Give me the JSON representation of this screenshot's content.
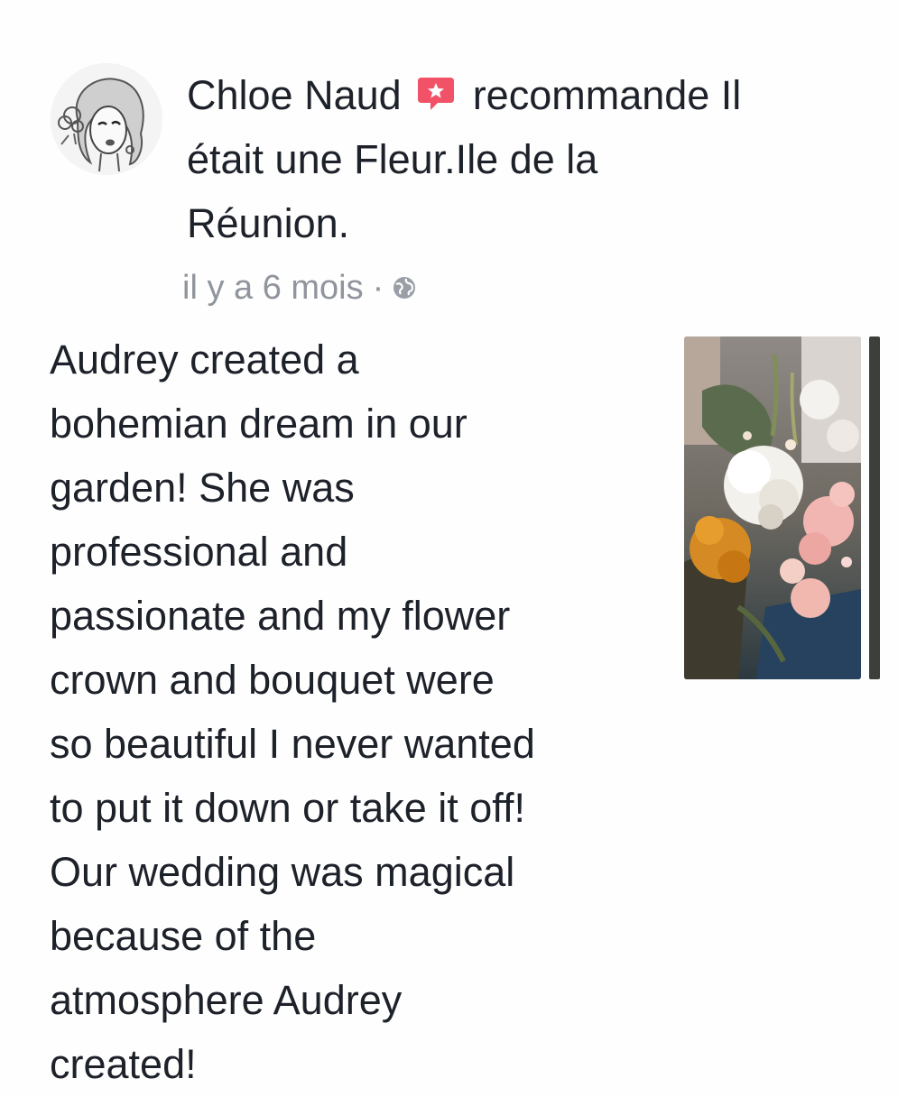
{
  "post": {
    "author": "Chloe Naud",
    "action_line_1": "recommande Il",
    "action_line_2": "était une Fleur.Ile de la",
    "action_line_3": "Réunion.",
    "timestamp": "il y a 6 mois",
    "separator": "·",
    "privacy_icon": "globe-icon",
    "recommend_icon": "recommend-icon",
    "recommend_color": "#f25268",
    "text_lines": [
      "Audrey created a",
      "bohemian dream in our",
      "garden! She was",
      "professional and",
      "passionate and my flower",
      "crown and bouquet were",
      "so beautiful I never wanted",
      "to put it down or take it off!",
      "Our wedding was magical",
      "because of the",
      "atmosphere Audrey",
      "created!"
    ]
  }
}
